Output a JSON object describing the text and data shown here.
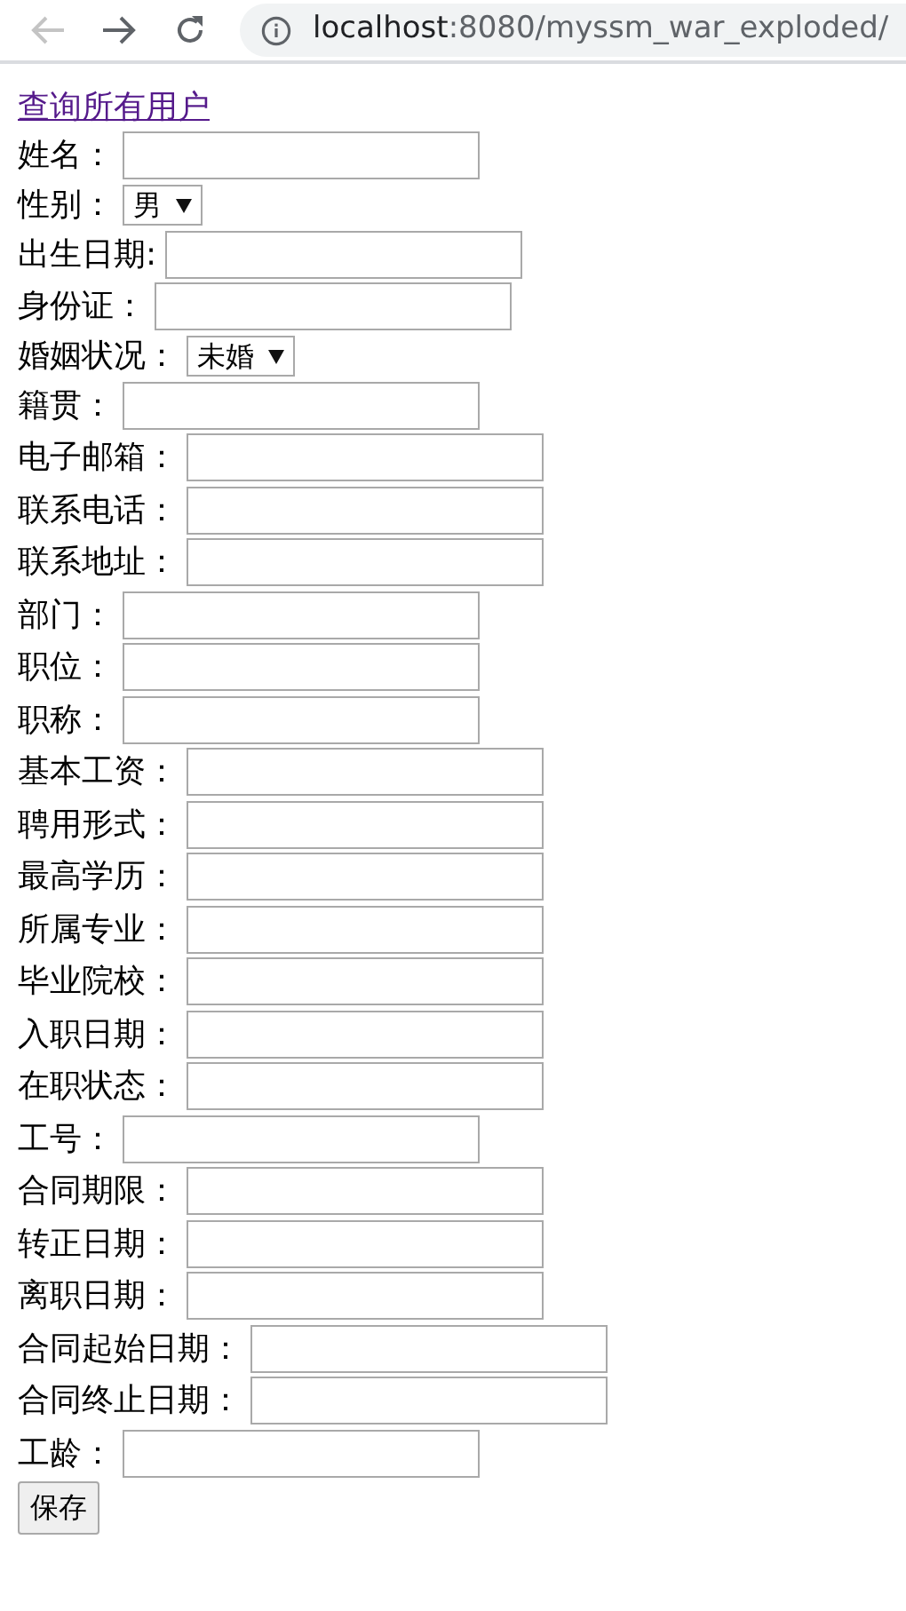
{
  "browser": {
    "back_disabled": true,
    "url_host": "localhost",
    "url_path": ":8080/myssm_war_exploded/"
  },
  "link": "查询所有用户",
  "fields": [
    {
      "kind": "input",
      "label": "姓名："
    },
    {
      "kind": "select",
      "label": "性别：",
      "value": "男"
    },
    {
      "kind": "input",
      "label": "出生日期:"
    },
    {
      "kind": "input",
      "label": "身份证："
    },
    {
      "kind": "select",
      "label": "婚姻状况：",
      "value": "未婚"
    },
    {
      "kind": "input",
      "label": "籍贯："
    },
    {
      "kind": "input",
      "label": "电子邮箱："
    },
    {
      "kind": "input",
      "label": "联系电话："
    },
    {
      "kind": "input",
      "label": "联系地址："
    },
    {
      "kind": "input",
      "label": "部门："
    },
    {
      "kind": "input",
      "label": "职位："
    },
    {
      "kind": "input",
      "label": "职称："
    },
    {
      "kind": "input",
      "label": "基本工资："
    },
    {
      "kind": "input",
      "label": "聘用形式："
    },
    {
      "kind": "input",
      "label": "最高学历："
    },
    {
      "kind": "input",
      "label": "所属专业："
    },
    {
      "kind": "input",
      "label": "毕业院校："
    },
    {
      "kind": "input",
      "label": "入职日期："
    },
    {
      "kind": "input",
      "label": "在职状态："
    },
    {
      "kind": "input",
      "label": "工号："
    },
    {
      "kind": "input",
      "label": "合同期限："
    },
    {
      "kind": "input",
      "label": "转正日期："
    },
    {
      "kind": "input",
      "label": "离职日期："
    },
    {
      "kind": "input",
      "label": "合同起始日期："
    },
    {
      "kind": "input",
      "label": "合同终止日期："
    },
    {
      "kind": "input",
      "label": "工龄："
    }
  ],
  "save_button": "保存"
}
